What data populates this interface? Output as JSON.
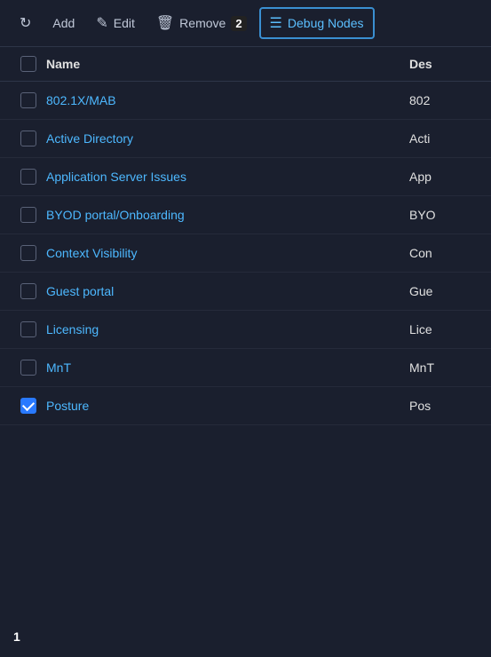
{
  "toolbar": {
    "add_label": "Add",
    "edit_label": "Edit",
    "remove_label": "Remove",
    "remove_badge": "2",
    "debug_label": "Debug Nodes",
    "refresh_icon": "↻",
    "edit_icon": "✎",
    "trash_icon": "🗑",
    "list_icon": "☰"
  },
  "table": {
    "col_name": "Name",
    "col_desc": "Des",
    "rows": [
      {
        "id": 1,
        "name": "802.1X/MAB",
        "desc": "802",
        "checked": false
      },
      {
        "id": 2,
        "name": "Active Directory",
        "desc": "Acti",
        "checked": false
      },
      {
        "id": 3,
        "name": "Application Server Issues",
        "desc": "App",
        "checked": false
      },
      {
        "id": 4,
        "name": "BYOD portal/Onboarding",
        "desc": "BYO",
        "checked": false
      },
      {
        "id": 5,
        "name": "Context Visibility",
        "desc": "Con",
        "checked": false
      },
      {
        "id": 6,
        "name": "Guest portal",
        "desc": "Gue",
        "checked": false
      },
      {
        "id": 7,
        "name": "Licensing",
        "desc": "Lice",
        "checked": false
      },
      {
        "id": 8,
        "name": "MnT",
        "desc": "MnT",
        "checked": false
      },
      {
        "id": 9,
        "name": "Posture",
        "desc": "Pos",
        "checked": true
      }
    ]
  },
  "footer": {
    "row_count": "1"
  }
}
